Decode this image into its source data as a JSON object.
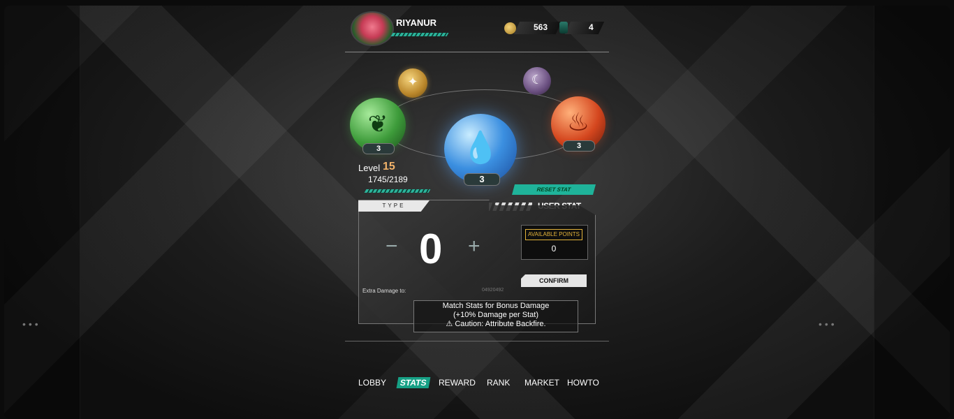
{
  "header": {
    "username": "RIYANUR",
    "coins": "563",
    "gems": "4"
  },
  "orbs": {
    "leaf_count": "3",
    "water_count": "3",
    "fire_count": "3"
  },
  "level": {
    "label": "Level",
    "value": "15",
    "xp": "1745/2189"
  },
  "stat_panel": {
    "reset_label": "RESET STAT",
    "user_stat_label": "USER STAT",
    "type_label": "TYPE",
    "minus": "−",
    "value": "0",
    "plus": "+",
    "available_points_label": "AVAILABLE POINTS",
    "available_points_value": "0",
    "confirm_label": "CONFIRM",
    "extra_damage_label": "Extra Damage to:",
    "extra_damage_value": "04920492",
    "note_line1": "Match Stats for Bonus Damage",
    "note_line2": "(+10% Damage per Stat)",
    "note_line3": "⚠ Caution: Attribute Backfire."
  },
  "nav": {
    "lobby": "LOBBY",
    "stats": "STATS",
    "reward": "REWARD",
    "rank": "RANK",
    "market": "MARKET",
    "howto": "HOWTO"
  },
  "colors": {
    "accent": "#1fb39a",
    "level_value": "#f2b36a",
    "available_points_border": "#e3b33a"
  }
}
